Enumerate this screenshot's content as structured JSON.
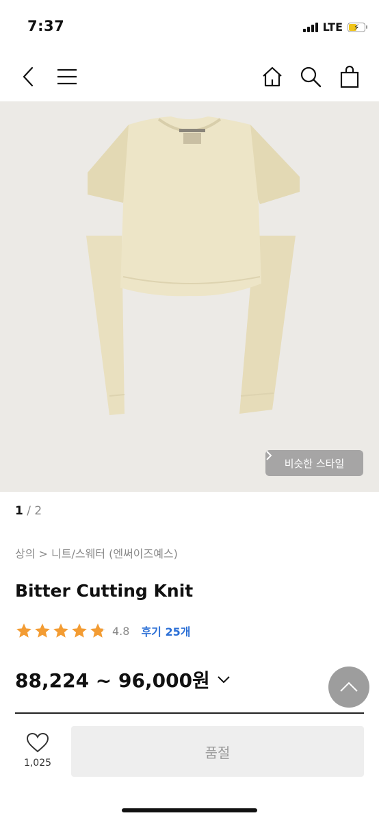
{
  "status": {
    "time": "7:37",
    "network": "LTE"
  },
  "nav": {
    "back_icon": "chevron-left-icon",
    "menu_icon": "hamburger-icon",
    "home_icon": "home-icon",
    "search_icon": "search-icon",
    "cart_icon": "shopping-bag-icon"
  },
  "image": {
    "similar_label": "비슷한 스타일",
    "background_color": "#eceae6",
    "product_color": "#ece4c6"
  },
  "pager": {
    "current": "1",
    "separator": " / ",
    "total": "2"
  },
  "breadcrumb": "상의 > 니트/스웨터 (엔써이즈예스)",
  "product": {
    "title": "Bitter Cutting Knit"
  },
  "rating": {
    "stars": 4.8,
    "score": "4.8",
    "review_label": "후기 25개"
  },
  "price": {
    "text": "88,224 ~ 96,000원"
  },
  "bottom": {
    "wish_count": "1,025",
    "soldout_label": "품절"
  },
  "colors": {
    "star": "#f39c33",
    "review_link": "#2b6fd6"
  }
}
